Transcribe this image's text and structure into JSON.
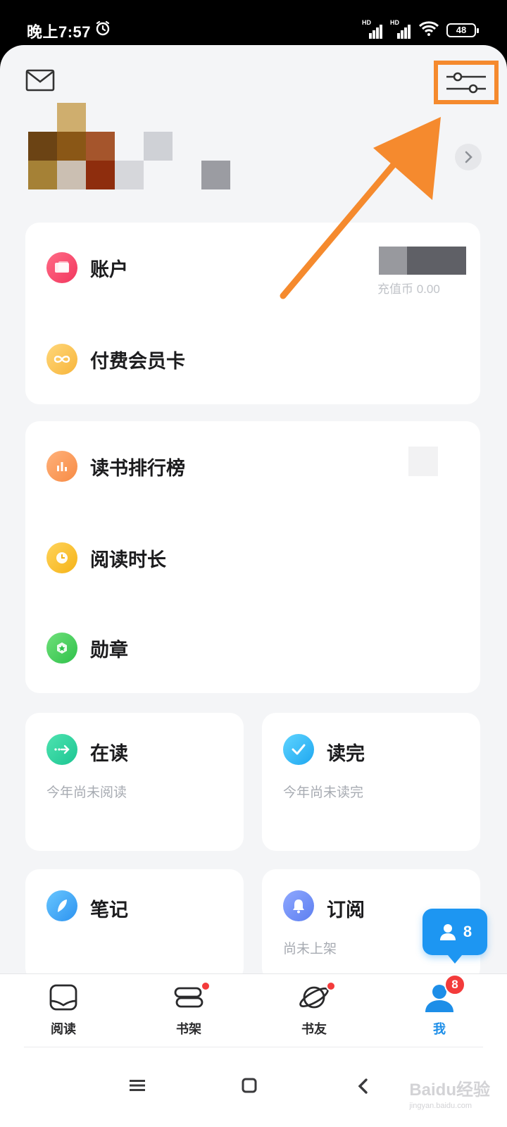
{
  "status_bar": {
    "time": "晚上7:57",
    "signal1_label": "HD",
    "signal2_label": "HD",
    "battery": "48"
  },
  "header": {
    "mail_icon": "mail-icon",
    "settings_icon": "sliders-icon"
  },
  "account_card": {
    "account_label": "账户",
    "account_sub": "充值币 0.00",
    "vip_label": "付费会员卡"
  },
  "stats_card": {
    "rank_label": "读书排行榜",
    "time_label": "阅读时长",
    "medal_label": "勋章"
  },
  "grid": [
    {
      "title": "在读",
      "subtitle": "今年尚未阅读"
    },
    {
      "title": "读完",
      "subtitle": "今年尚未读完"
    },
    {
      "title": "笔记",
      "subtitle": ""
    },
    {
      "title": "订阅",
      "subtitle": "尚未上架"
    }
  ],
  "floating_friend": {
    "count": "8"
  },
  "tabbar": {
    "tabs": [
      {
        "label": "阅读"
      },
      {
        "label": "书架"
      },
      {
        "label": "书友"
      },
      {
        "label": "我",
        "badge": "8"
      }
    ]
  },
  "watermark": {
    "brand": "Baidu经验",
    "url": "jingyan.baidu.com"
  },
  "colors": {
    "accent_blue": "#1d8ee8",
    "highlight_orange": "#f58a2e",
    "badge_red": "#f33b3b"
  }
}
